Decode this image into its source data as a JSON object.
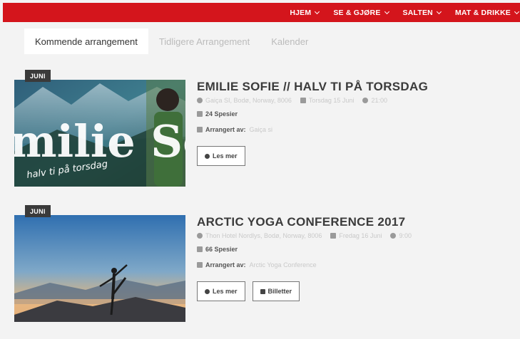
{
  "nav": {
    "items": [
      {
        "label": "HJEM"
      },
      {
        "label": "SE & GJØRE"
      },
      {
        "label": "SALTEN"
      },
      {
        "label": "MAT & DRIKKE"
      }
    ]
  },
  "tabs": [
    {
      "label": "Kommende arrangement"
    },
    {
      "label": "Tidligere Arrangement"
    },
    {
      "label": "Kalender"
    }
  ],
  "events": [
    {
      "badge": "JUNI",
      "title": "EMILIE SOFIE // HALV TI PÅ TORSDAG",
      "image_text": "milie So",
      "image_subtext": "halv ti på torsdag",
      "location": "Gaiça SI, Bodø, Norway, 8006",
      "date": "Torsdag 15 Juni",
      "time": "21:00",
      "interested": "24 Spesier",
      "organizer_label": "Arrangert av:",
      "organizer": "Gaiça si",
      "read_more": "Les mer"
    },
    {
      "badge": "JUNI",
      "title": "ARCTIC YOGA CONFERENCE 2017",
      "location": "Thon Hotel Nordlys, Bodø, Norway, 8006",
      "date": "Fredag 16 Juni",
      "time": "9:00",
      "interested": "66 Spesier",
      "organizer_label": "Arrangert av:",
      "organizer": "Arctic Yoga Conference",
      "read_more": "Les mer",
      "tickets": "Billetter"
    }
  ],
  "colors": {
    "accent": "#d4151c",
    "background": "#f3f3f3"
  }
}
